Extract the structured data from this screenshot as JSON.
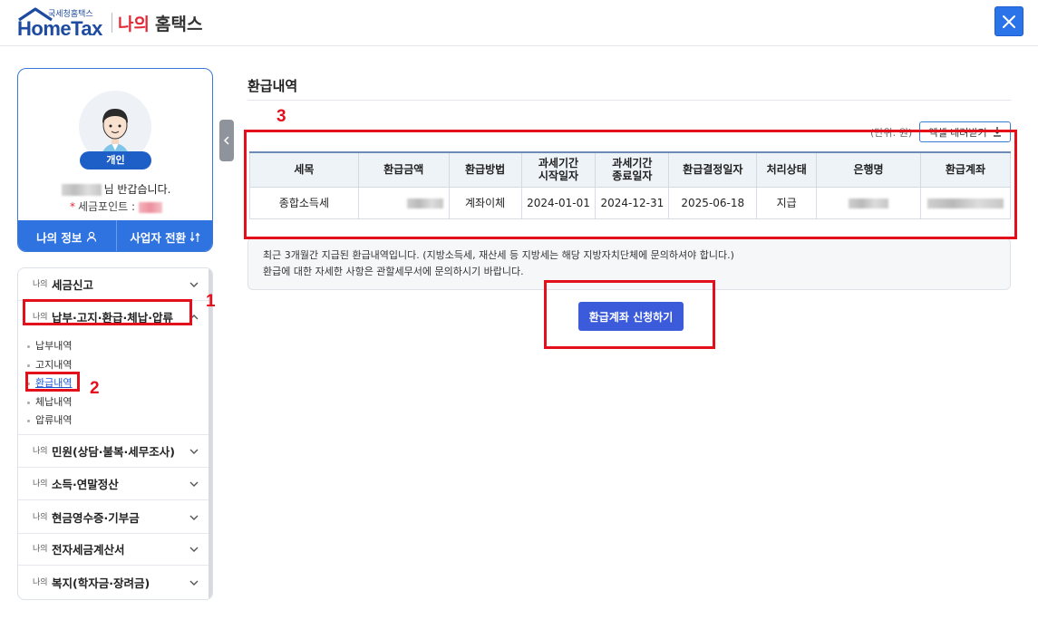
{
  "header": {
    "logo_small": "국세청홈택스",
    "logo_big": "HomeTax",
    "title_my": "나의",
    "title_rest": "홈택스"
  },
  "profile": {
    "badge": "개인",
    "greeting_suffix": "님 반갑습니다.",
    "points_label": "세금포인트 :",
    "btn_my_info": "나의 정보",
    "btn_switch": "사업자 전환"
  },
  "menu": {
    "prefix": "나의",
    "items": [
      {
        "label": "세금신고"
      },
      {
        "label": "납부·고지·환급·체납·압류"
      },
      {
        "label": "민원(상담·불복·세무조사)"
      },
      {
        "label": "소득·연말정산"
      },
      {
        "label": "현금영수증·기부금"
      },
      {
        "label": "전자세금계산서"
      },
      {
        "label": "복지(학자금·장려금)"
      }
    ],
    "submenu": [
      "납부내역",
      "고지내역",
      "환급내역",
      "체납내역",
      "압류내역"
    ]
  },
  "annotations": [
    "1",
    "2",
    "3"
  ],
  "content": {
    "title": "환급내역",
    "unit": "(단위: 원)",
    "excel_btn": "엑셀 내려받기",
    "table": {
      "headers": [
        "세목",
        "환급금액",
        "환급방법",
        "과세기간\n시작일자",
        "과세기간\n종료일자",
        "환급결정일자",
        "처리상태",
        "은행명",
        "환급계좌"
      ],
      "rows": [
        [
          "종합소득세",
          "",
          "계좌이체",
          "2024-01-01",
          "2024-12-31",
          "2025-06-18",
          "지급",
          "",
          ""
        ]
      ]
    },
    "info_line1": "최근 3개월간 지급된 환급내역입니다. (지방소득세, 재산세 등 지방세는 해당 지방자치단체에 문의하셔야 합니다.)",
    "info_line2": "환급에 대한 자세한 사항은 관할세무서에 문의하시기 바랍니다.",
    "apply_btn": "환급계좌 신청하기"
  },
  "colors": {
    "brand_blue": "#1e4ba0",
    "accent_blue": "#2f73e0",
    "annotation_red": "#e3101c",
    "apply_button": "#3b5bdb"
  }
}
